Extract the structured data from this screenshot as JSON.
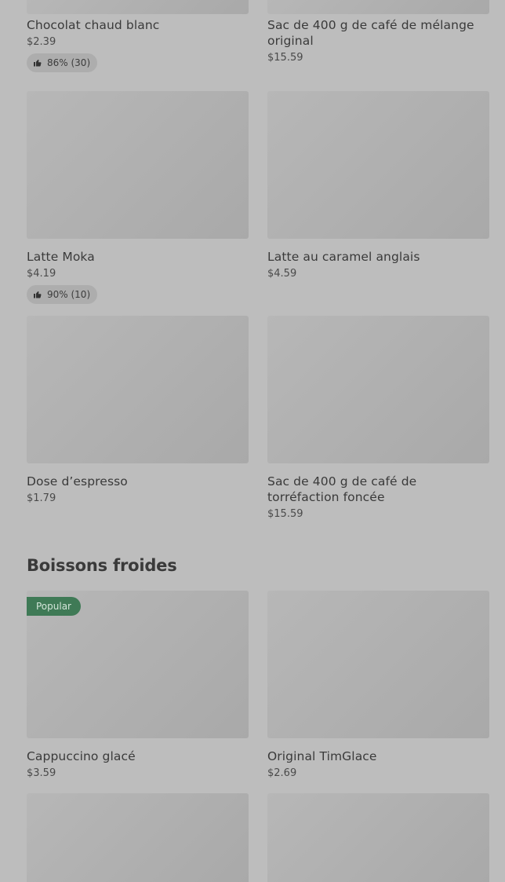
{
  "rows": [
    [
      {
        "name": "Chocolat chaud blanc",
        "price": "$2.39",
        "rating": "86% (30)"
      },
      {
        "name": "Sac de 400 g de café de mélange original",
        "price": "$15.59"
      }
    ],
    [
      {
        "name": "Latte Moka",
        "price": "$4.19",
        "rating": "90% (10)"
      },
      {
        "name": "Latte au caramel anglais",
        "price": "$4.59"
      }
    ],
    [
      {
        "name": "Dose d’espresso",
        "price": "$1.79"
      },
      {
        "name": "Sac de 400 g de café de torréfaction foncée",
        "price": "$15.59"
      }
    ]
  ],
  "cold_section": {
    "title": "Boissons froides",
    "rows": [
      [
        {
          "name": "Cappuccino glacé",
          "price": "$3.59",
          "badge": "Popular"
        },
        {
          "name": "Original TimGlace",
          "price": "$2.69"
        }
      ]
    ]
  },
  "icons": {
    "rating": "thumbs-up-icon"
  },
  "colors": {
    "badge_bg": "#3f7a56",
    "page_bg": "#bdbdbd"
  }
}
